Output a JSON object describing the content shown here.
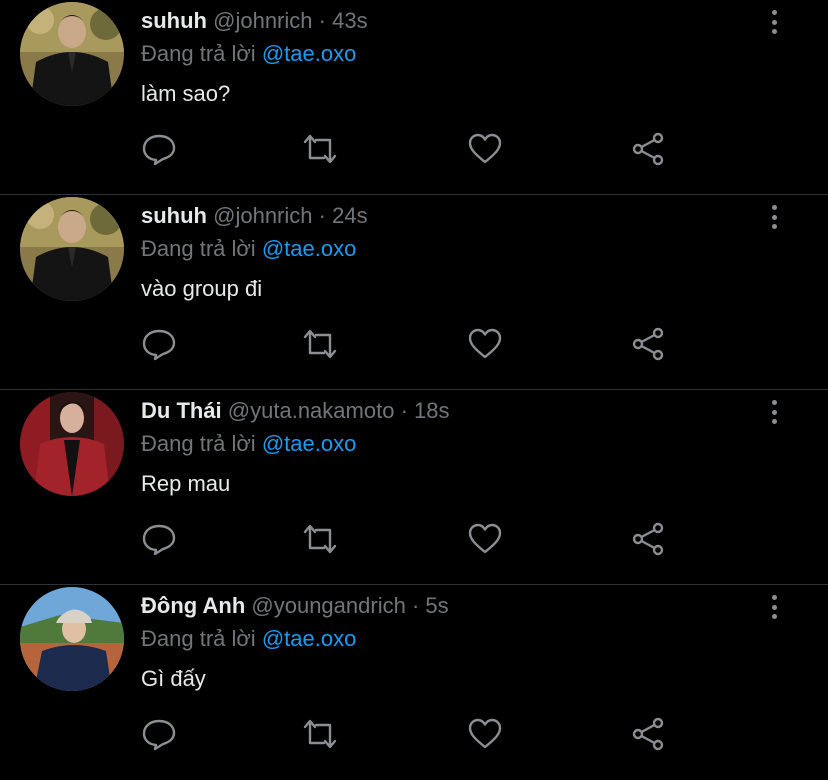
{
  "reply_prefix": "Đang trả lời",
  "colors": {
    "background": "#000000",
    "text": "#e7e9ea",
    "muted": "#71767b",
    "accent": "#1d9bf0",
    "divider": "#2f3336"
  },
  "action_icons": [
    "reply-icon",
    "retweet-icon",
    "like-icon",
    "share-icon"
  ],
  "tweets": [
    {
      "display_name": "suhuh",
      "handle": "@johnrich",
      "separator": "·",
      "time": "43s",
      "reply_to": "@tae.oxo",
      "text": "làm sao?"
    },
    {
      "display_name": "suhuh",
      "handle": "@johnrich",
      "separator": "·",
      "time": "24s",
      "reply_to": "@tae.oxo",
      "text": "vào group đi"
    },
    {
      "display_name": "Du Thái",
      "handle": "@yuta.nakamoto",
      "separator": "·",
      "time": "18s",
      "reply_to": "@tae.oxo",
      "text": "Rep mau"
    },
    {
      "display_name": "Đông Anh",
      "handle": "@youngandrich",
      "separator": "·",
      "time": "5s",
      "reply_to": "@tae.oxo",
      "text": "Gì đấy"
    }
  ]
}
